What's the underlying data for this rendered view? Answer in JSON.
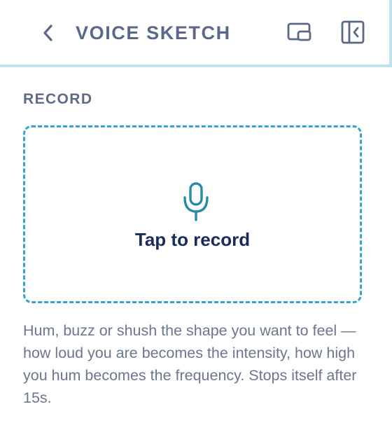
{
  "header": {
    "title": "VOICE SKETCH",
    "back_icon": "chevron-left-icon",
    "pip_icon": "picture-in-picture-icon",
    "collapse_icon": "collapse-panel-icon"
  },
  "record": {
    "section_label": "RECORD",
    "mic_icon": "microphone-icon",
    "cta_label": "Tap to record",
    "help_text": "Hum, buzz or shush the shape you want to feel — how loud you are becomes the intensity, how high you hum becomes the frequency. Stops itself after 15s."
  },
  "colors": {
    "accent": "#3aa1cb",
    "mic": "#2a8aa6",
    "title_text": "#5a6889",
    "cta_text": "#1b2c5c",
    "help_text": "#6b7690",
    "divider": "#c2e2ea"
  }
}
